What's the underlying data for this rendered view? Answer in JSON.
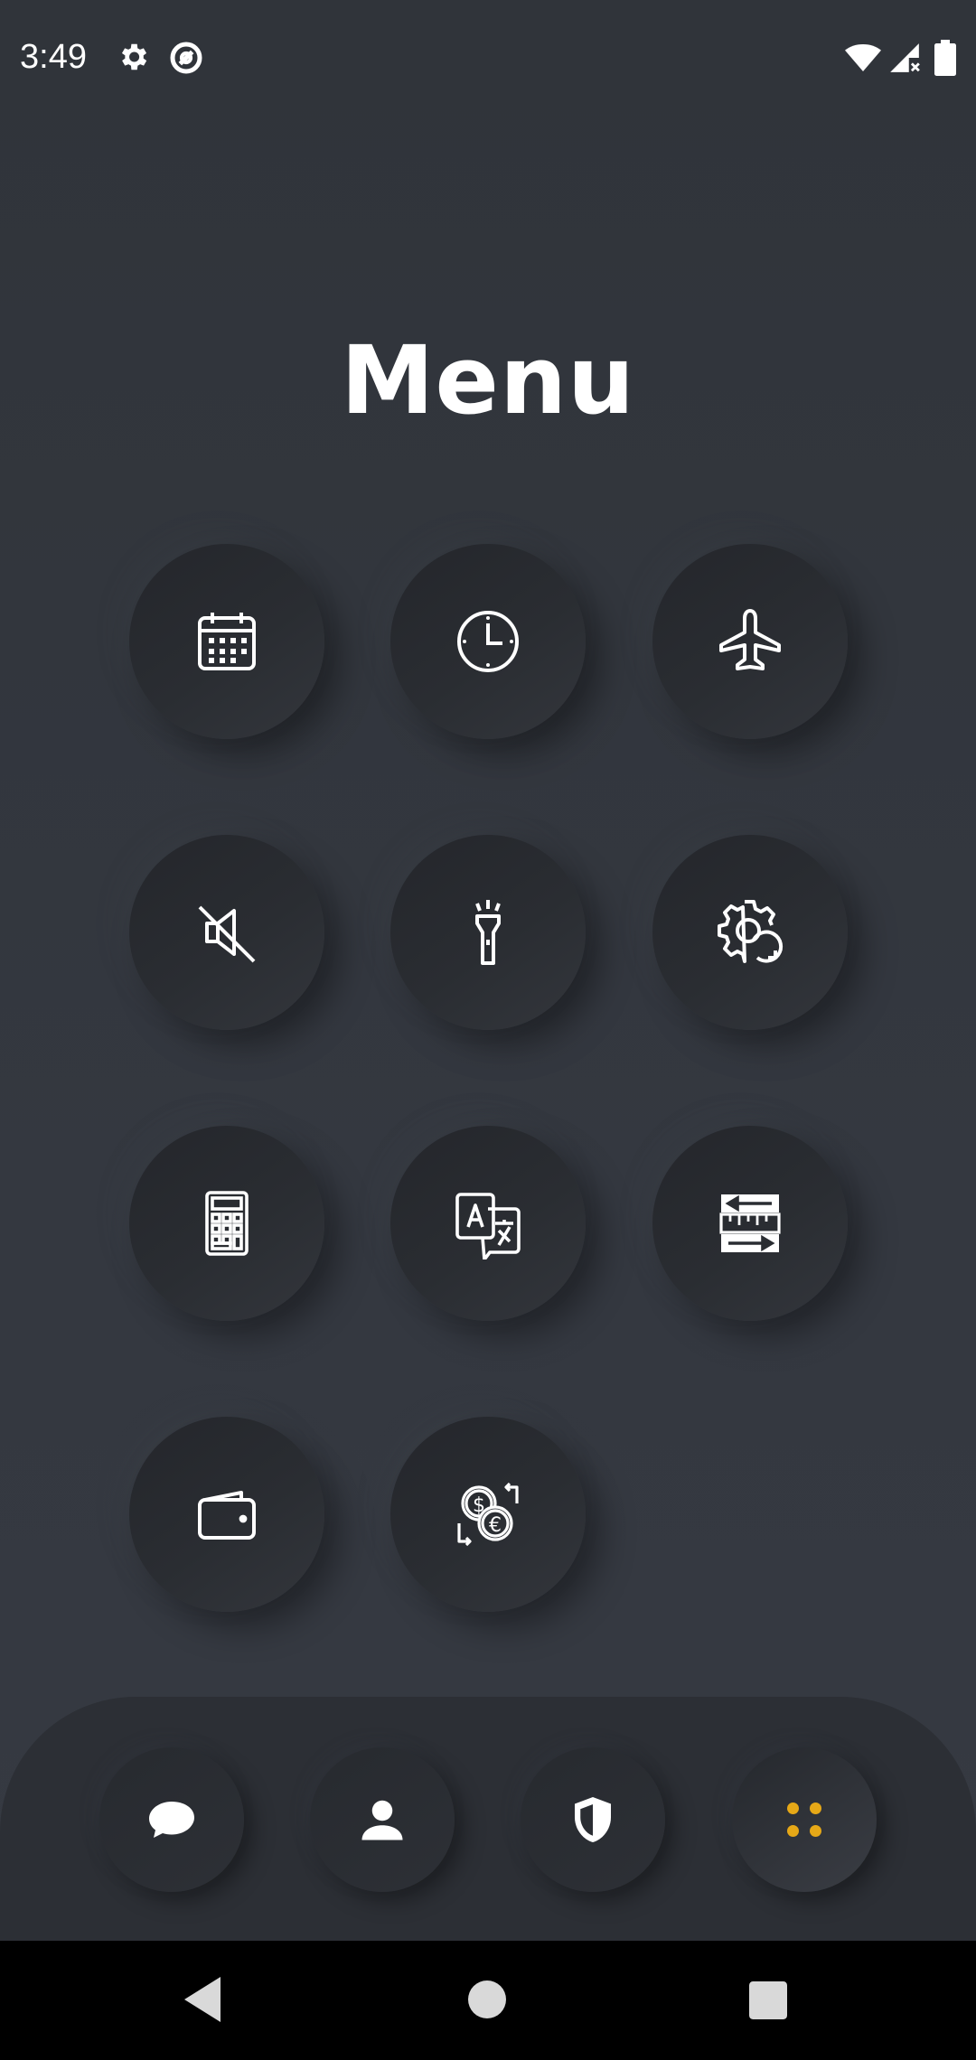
{
  "status_bar": {
    "time": "3:49",
    "icons": [
      "settings-icon",
      "no-data-icon",
      "wifi-icon",
      "cell-signal-icon",
      "battery-icon"
    ]
  },
  "title": "Menu",
  "menu_items": [
    {
      "icon": "calendar-icon"
    },
    {
      "icon": "clock-icon"
    },
    {
      "icon": "airplane-icon"
    },
    {
      "icon": "mute-icon"
    },
    {
      "icon": "flashlight-icon"
    },
    {
      "icon": "gear-refresh-icon"
    },
    {
      "icon": "calculator-icon"
    },
    {
      "icon": "translate-icon"
    },
    {
      "icon": "unit-converter-icon"
    },
    {
      "icon": "wallet-icon"
    },
    {
      "icon": "currency-exchange-icon"
    }
  ],
  "bottom_nav": [
    {
      "icon": "chat-icon",
      "active": false
    },
    {
      "icon": "person-icon",
      "active": false
    },
    {
      "icon": "shield-icon",
      "active": false
    },
    {
      "icon": "grid-dots-icon",
      "active": true
    }
  ],
  "colors": {
    "background": "#33373e",
    "accent": "#e6a817",
    "icon": "#ffffff",
    "system_nav": "#000000"
  },
  "system_nav": [
    "back-icon",
    "home-icon",
    "recents-icon"
  ]
}
